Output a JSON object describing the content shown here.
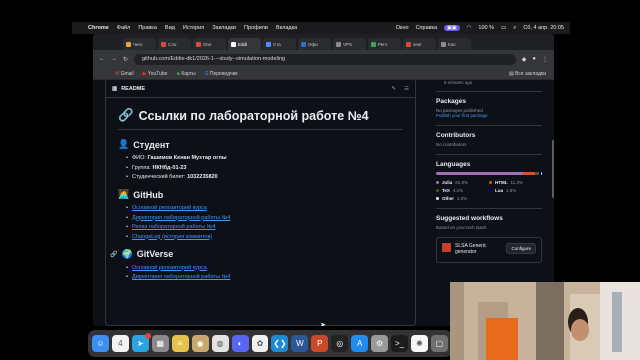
{
  "menubar": {
    "app": "Chrome",
    "items": [
      "Файл",
      "Правка",
      "Вид",
      "История",
      "Закладки",
      "Профили",
      "Вкладка"
    ],
    "right_items": [
      "Окно",
      "Справка"
    ],
    "battery": "100 %",
    "datetime": "Сб, 4 апр.  20:05"
  },
  "browser": {
    "tabs": [
      {
        "label": "Чего",
        "color": "#e9a43b"
      },
      {
        "label": "Сло",
        "color": "#d94a3a"
      },
      {
        "label": "One",
        "color": "#d94a3a"
      },
      {
        "label": "Eddi",
        "color": "#ffffff",
        "active": true
      },
      {
        "label": "Ста",
        "color": "#4f8cf7"
      },
      {
        "label": "Офи",
        "color": "#2f6fd0"
      },
      {
        "label": "VPS",
        "color": "#8d8d8d"
      },
      {
        "label": "Регл",
        "color": "#3aa757"
      },
      {
        "label": "seer",
        "color": "#d94a3a"
      },
      {
        "label": "Кап",
        "color": "#8d8d8d"
      }
    ],
    "url": "github.com/Eddie-dk1/2026-1---study--simulation-modeling",
    "bookmarks": [
      "Gmail",
      "YouTube",
      "Карты",
      "Переводчик"
    ],
    "bookmarks_end": "Все закладки"
  },
  "readme": {
    "tab_label": "README",
    "title": "Ссылки по лабораторной работе №4",
    "student_heading": "Студент",
    "student": [
      {
        "k": "ФИО: ",
        "v": "Гашимов Кенан Мухтар оглы"
      },
      {
        "k": "Группа: ",
        "v": "НКНбд-01-23"
      },
      {
        "k": "Студенческий билет: ",
        "v": "1032235820"
      }
    ],
    "github_heading": "GitHub",
    "github_links": [
      "Основной репозиторий курса",
      "Директория лабораторной работы №4",
      "Релиз лабораторной работы №4",
      "ChangeLog (история коммитов)"
    ],
    "gitverse_heading": "GitVerse",
    "gitverse_links": [
      "Основной репозиторий курса",
      "Директория лабораторной работы №4"
    ]
  },
  "sidebar": {
    "time_ago": "6 minutes ago",
    "packages_title": "Packages",
    "packages_text": "No packages published",
    "packages_link": "Publish your first package",
    "contributors_title": "Contributors",
    "contributors_text": "No contributors",
    "languages_title": "Languages",
    "languages": [
      {
        "name": "Julia",
        "pct": "81.8%",
        "color": "#a270ba",
        "value": 81.8
      },
      {
        "name": "HTML",
        "pct": "11.3%",
        "color": "#e34c26",
        "value": 11.3
      },
      {
        "name": "TeX",
        "pct": "4.1%",
        "color": "#3d6117",
        "value": 4.1
      },
      {
        "name": "Lua",
        "pct": "1.8%",
        "color": "#000080",
        "value": 1.8
      },
      {
        "name": "Other",
        "pct": "1.0%",
        "color": "#ededed",
        "value": 1.0
      }
    ],
    "workflows_title": "Suggested workflows",
    "workflows_sub": "Based on your tech stack",
    "workflow_name": "SLSA Generic generator",
    "configure_label": "Configure"
  },
  "dock": [
    {
      "name": "finder-icon",
      "color": "#3b8ff3",
      "glyph": "☺"
    },
    {
      "name": "calendar-icon",
      "color": "#f2f2f2",
      "glyph": "4"
    },
    {
      "name": "telegram-icon",
      "color": "#2aa3e0",
      "glyph": "➤",
      "badge": "•"
    },
    {
      "name": "launchpad-icon",
      "color": "#8a8a8a",
      "glyph": "▦"
    },
    {
      "name": "notes-icon",
      "color": "#e5c24a",
      "glyph": "≡"
    },
    {
      "name": "preview-icon",
      "color": "#c9a96b",
      "glyph": "◉"
    },
    {
      "name": "chrome-icon",
      "color": "#e3e3e3",
      "glyph": "◍"
    },
    {
      "name": "discord-icon",
      "color": "#5865f2",
      "glyph": "◐"
    },
    {
      "name": "photos-icon",
      "color": "#f0f0f0",
      "glyph": "✿"
    },
    {
      "name": "vscode-icon",
      "color": "#1f8ad2",
      "glyph": "❮❯"
    },
    {
      "name": "word-icon",
      "color": "#2b5797",
      "glyph": "W"
    },
    {
      "name": "powerpoint-icon",
      "color": "#c84a2b",
      "glyph": "P"
    },
    {
      "name": "obs-icon",
      "color": "#222",
      "glyph": "◎"
    },
    {
      "name": "appstore-icon",
      "color": "#1f8cf0",
      "glyph": "A"
    },
    {
      "name": "settings-icon",
      "color": "#9a9a9a",
      "glyph": "⚙"
    },
    {
      "name": "terminal-icon",
      "color": "#1c1c1c",
      "glyph": ">_"
    },
    {
      "name": "pinwheel-icon",
      "color": "#f7f7f7",
      "glyph": "✺"
    },
    {
      "name": "trash-icon",
      "color": "#6f6f72",
      "glyph": "▢"
    }
  ]
}
